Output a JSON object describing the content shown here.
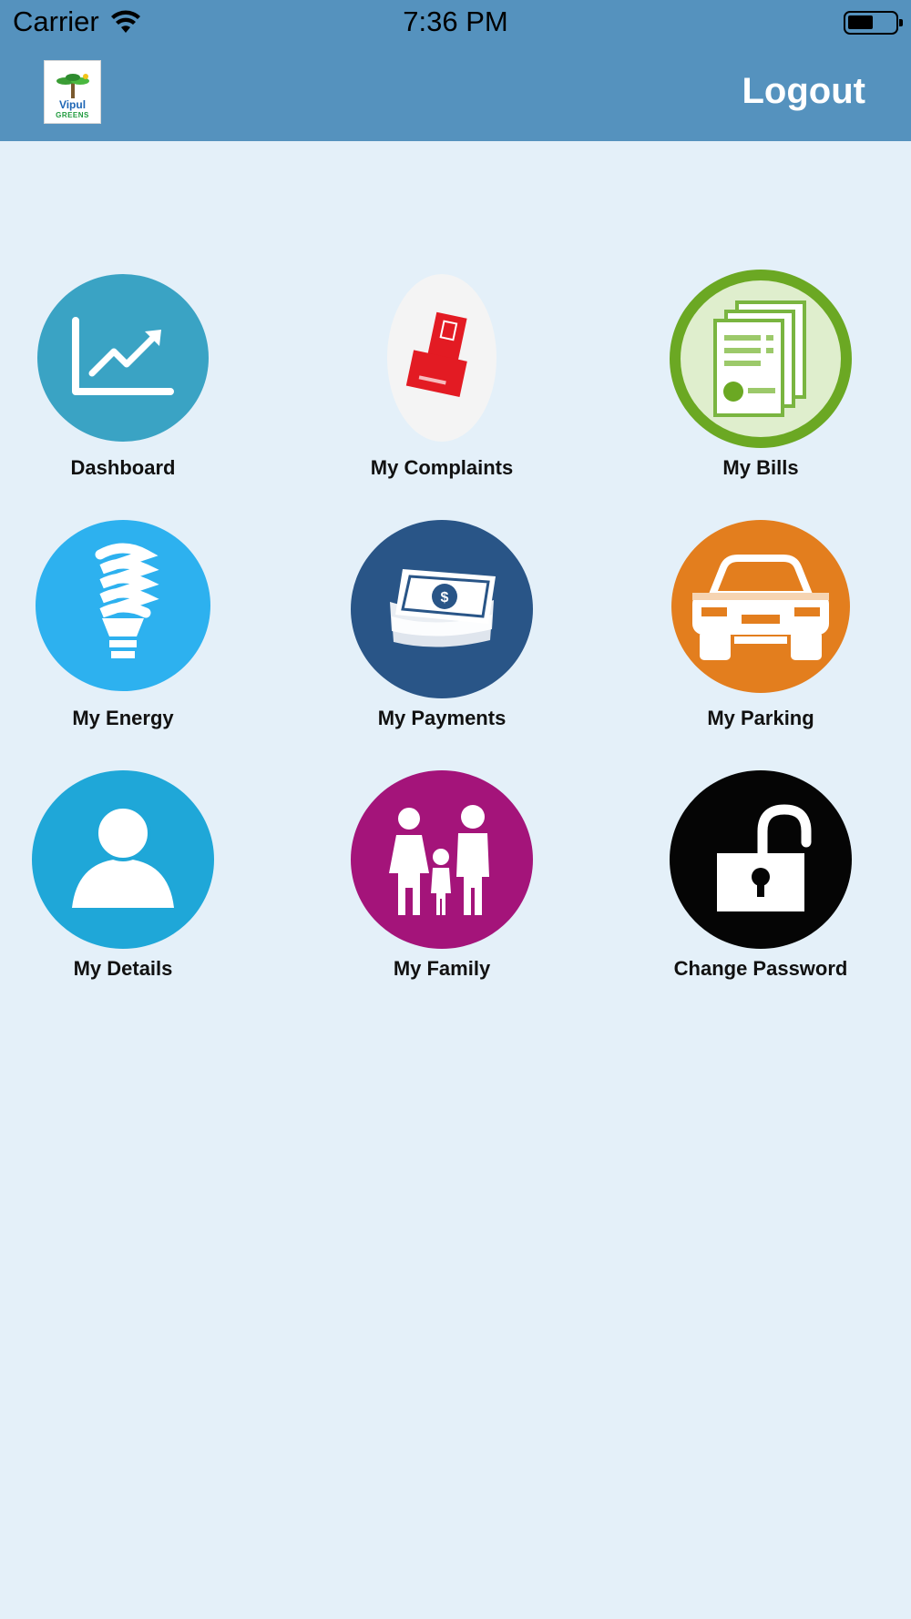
{
  "status_bar": {
    "carrier": "Carrier",
    "time": "7:36 PM",
    "wifi_icon": "wifi-icon",
    "battery_icon": "battery-icon"
  },
  "header": {
    "logo_line1": "Vipul",
    "logo_line2": "GREENS",
    "logout_label": "Logout",
    "bar_color": "#5592be"
  },
  "tiles": [
    {
      "label": "Dashboard",
      "icon": "chart-trend-icon",
      "color": "#3aa3c4"
    },
    {
      "label": "My Complaints",
      "icon": "complaint-card-icon",
      "color": "#f4f4f4"
    },
    {
      "label": "My Bills",
      "icon": "bill-document-icon",
      "color": "#6ba823"
    },
    {
      "label": "My Energy",
      "icon": "light-bulb-icon",
      "color": "#2db1ef"
    },
    {
      "label": "My Payments",
      "icon": "money-icon",
      "color": "#295587"
    },
    {
      "label": "My Parking",
      "icon": "car-icon",
      "color": "#e37e1e"
    },
    {
      "label": "My Details",
      "icon": "user-icon",
      "color": "#1fa7d8"
    },
    {
      "label": "My Family",
      "icon": "family-icon",
      "color": "#a4147a"
    },
    {
      "label": "Change Password",
      "icon": "padlock-icon",
      "color": "#050505"
    }
  ]
}
